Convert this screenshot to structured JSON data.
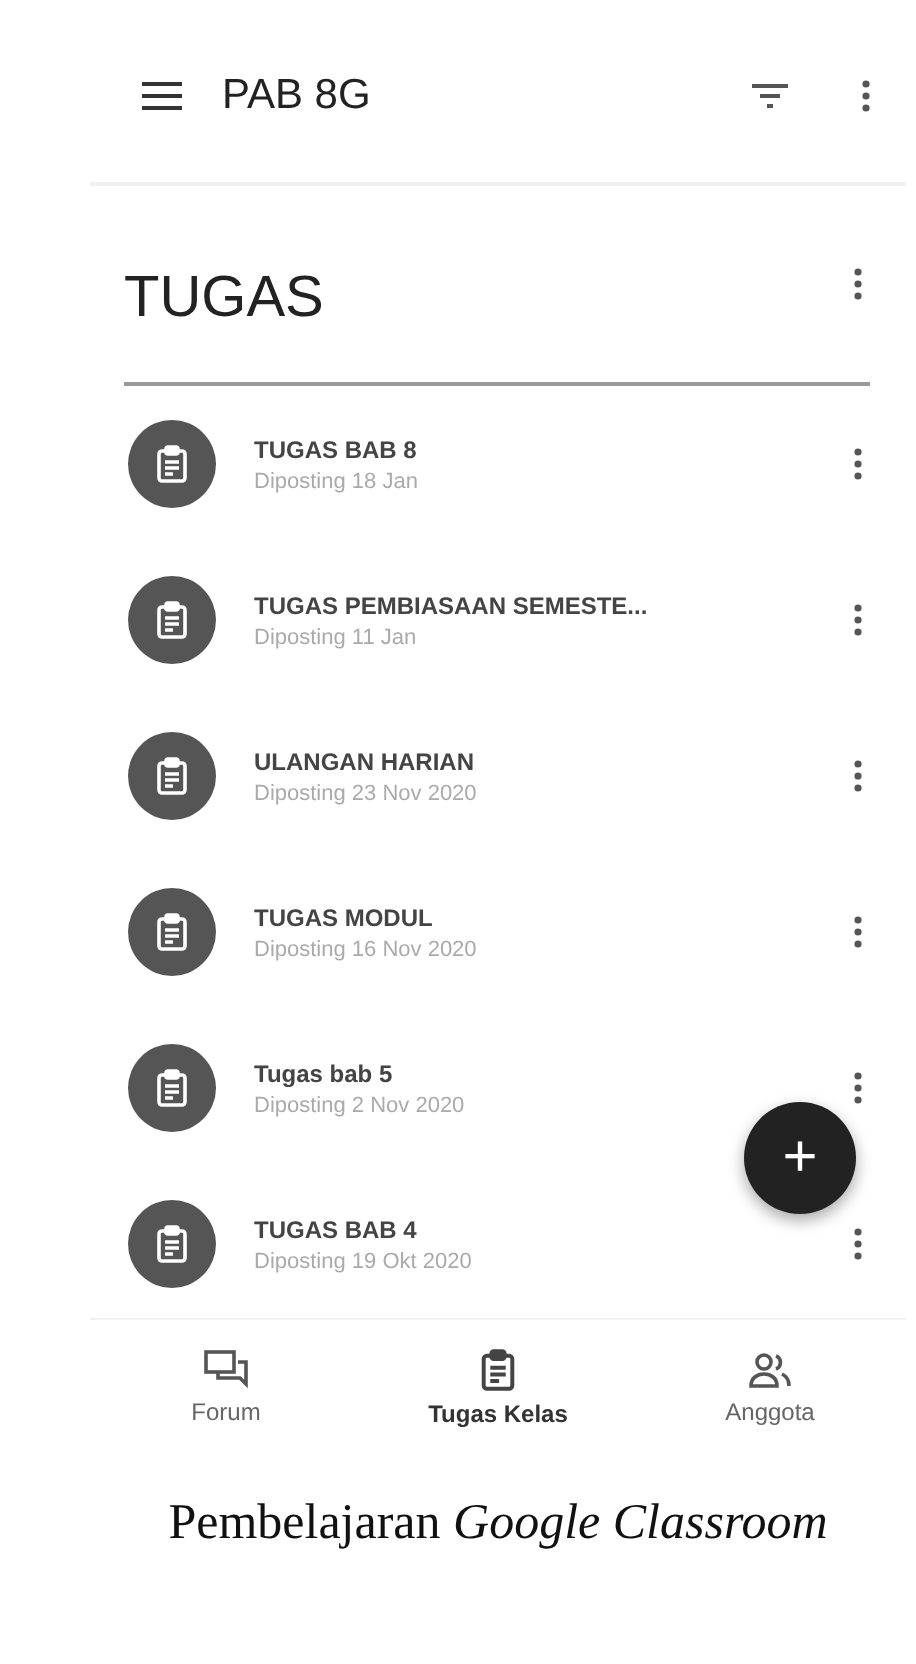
{
  "app_bar": {
    "title": "PAB 8G"
  },
  "topic": {
    "title": "TUGAS"
  },
  "assignments": [
    {
      "title": "TUGAS BAB 8",
      "posted": "Diposting 18 Jan"
    },
    {
      "title": "TUGAS PEMBIASAAN SEMESTE...",
      "posted": "Diposting 11 Jan"
    },
    {
      "title": "ULANGAN HARIAN",
      "posted": "Diposting 23 Nov 2020"
    },
    {
      "title": "TUGAS MODUL",
      "posted": "Diposting 16 Nov 2020"
    },
    {
      "title": "Tugas bab 5",
      "posted": "Diposting 2 Nov 2020"
    },
    {
      "title": "TUGAS BAB 4",
      "posted": "Diposting 19 Okt 2020"
    }
  ],
  "fab": {
    "label": "+"
  },
  "bottom_nav": [
    {
      "kind": "forum",
      "label": "Forum",
      "selected": false
    },
    {
      "kind": "classwork",
      "label": "Tugas Kelas",
      "selected": true
    },
    {
      "kind": "people",
      "label": "Anggota",
      "selected": false
    }
  ],
  "caption": "Pembelajaran *Google Classroom*"
}
